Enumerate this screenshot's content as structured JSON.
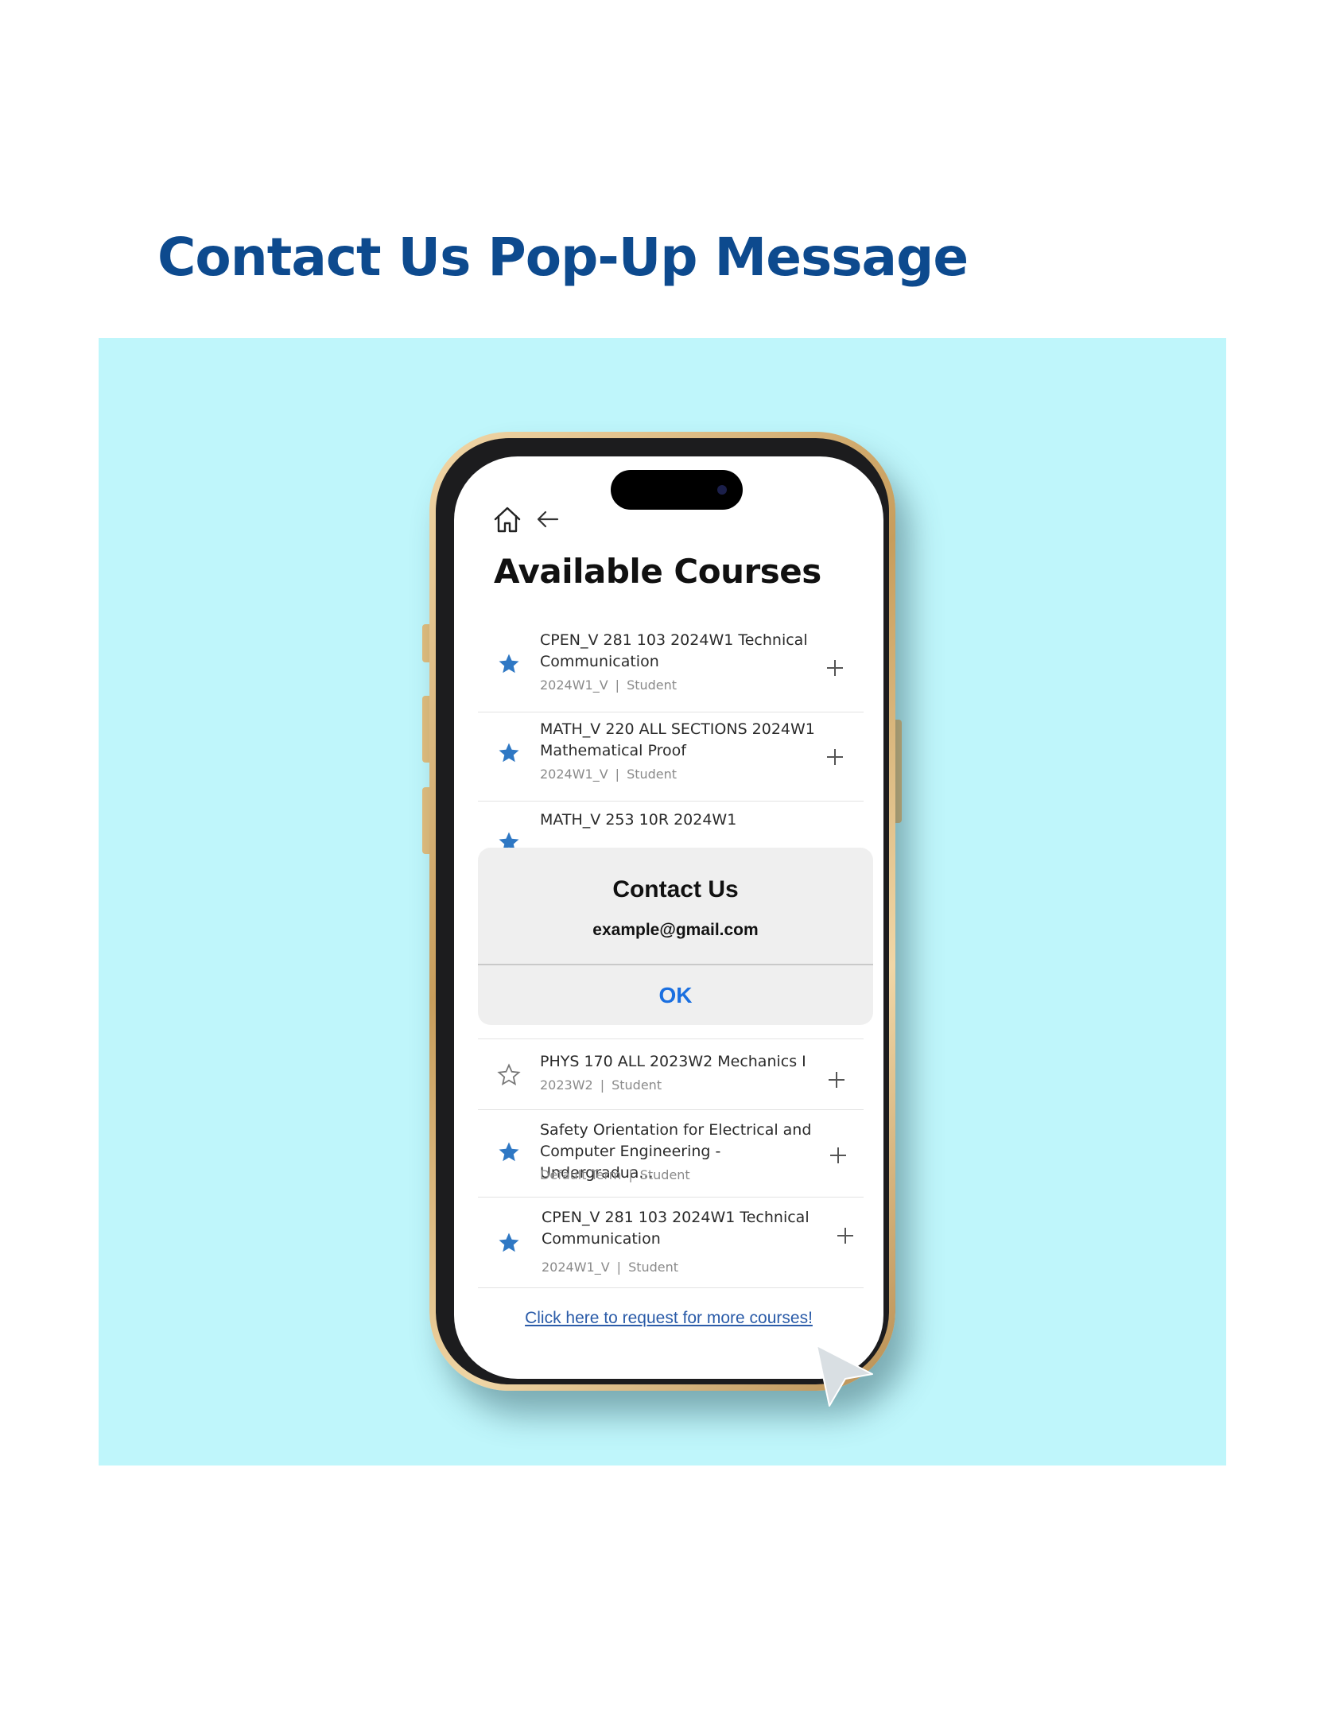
{
  "page": {
    "heading": "Contact Us Pop-Up Message"
  },
  "colors": {
    "heading": "#0d4a8e",
    "backdrop": "#bff6fb",
    "phone_frame": "#e2bd7c",
    "star_filled": "#2f78c4",
    "ok_button": "#1a6fe0",
    "link": "#2a5ba8"
  },
  "screen": {
    "nav": {
      "home_icon": "home-icon",
      "back_icon": "arrow-left-icon"
    },
    "title": "Available Courses",
    "courses_top": [
      {
        "name": "CPEN_V 281 103 2024W1 Technical Communication",
        "term": "2024W1_V",
        "role": "Student",
        "favorite": true
      },
      {
        "name": "MATH_V 220 ALL SECTIONS 2024W1 Mathematical Proof",
        "term": "2024W1_V",
        "role": "Student",
        "favorite": true
      },
      {
        "name": "MATH_V 253 10R 2024W1",
        "favorite": true
      }
    ],
    "courses_bottom": [
      {
        "name": "PHYS 170 ALL 2023W2 Mechanics I",
        "term": "2023W2",
        "role": "Student",
        "favorite": false
      },
      {
        "name": "Safety Orientation for Electrical and Computer Engineering - Undergradua...",
        "term": "Default Term",
        "role": "Student",
        "favorite": true
      },
      {
        "name": "CPEN_V 281 103 2024W1 Technical Communication",
        "term": "2024W1_V",
        "role": "Student",
        "favorite": true
      }
    ],
    "meta_separator": "|",
    "request_link": "Click here to request for more courses!"
  },
  "dialog": {
    "title": "Contact Us",
    "message": "example@gmail.com",
    "ok_label": "OK"
  }
}
